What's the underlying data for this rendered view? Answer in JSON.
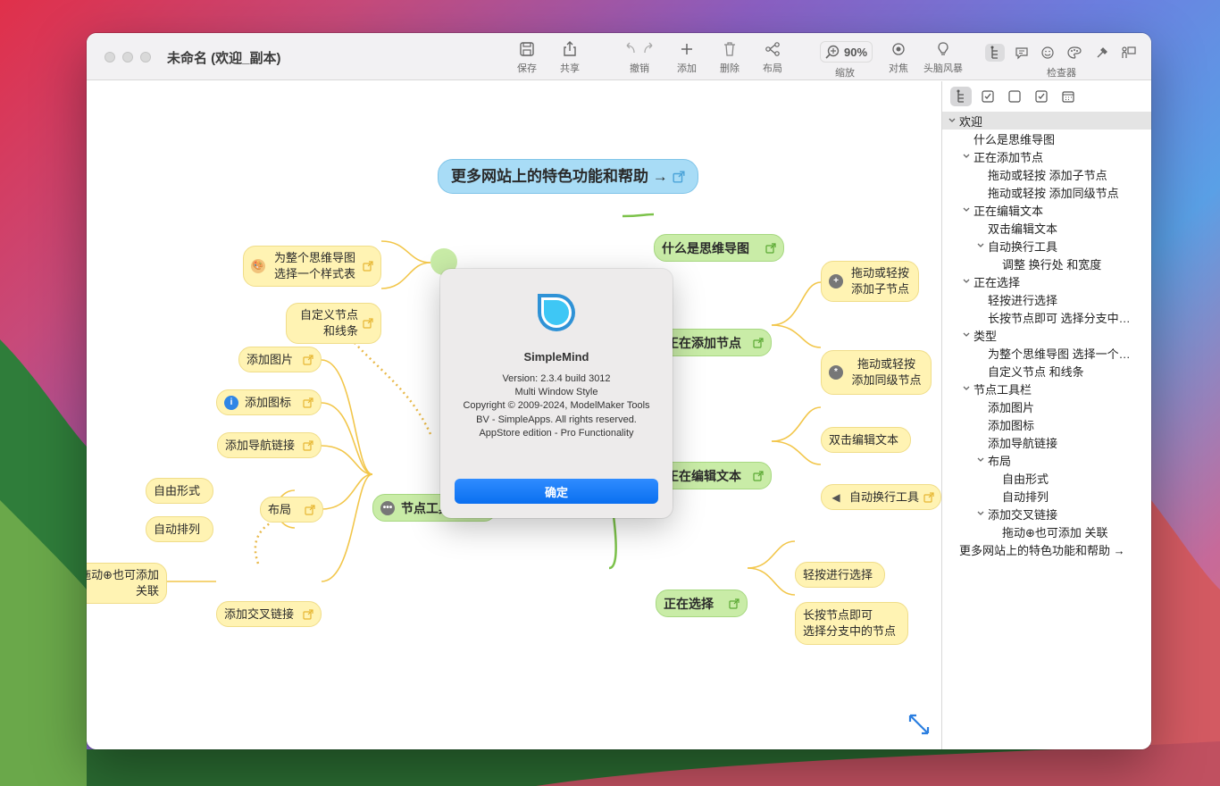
{
  "window": {
    "title": "未命名 (欢迎_副本)"
  },
  "toolbar": {
    "save": "保存",
    "share": "共享",
    "undo": "撤销",
    "add": "添加",
    "delete": "删除",
    "layout": "布局",
    "zoom": "缩放",
    "zoom_value": "90%",
    "focus": "对焦",
    "brainstorm": "头脑风暴",
    "inspector": "检查器"
  },
  "mindmap": {
    "top_link": "更多网站上的特色功能和帮助 →",
    "n_style": "为整个思维导图\n选择一个样式表",
    "n_custom": "自定义节点\n和线条",
    "n_addimg": "添加图片",
    "n_addicon": "添加图标",
    "n_addnav": "添加导航链接",
    "n_free": "自由形式",
    "n_auto": "自动排列",
    "n_layout": "布局",
    "n_cross_rel": "拖动⊕也可添加\n关联",
    "n_cross": "添加交叉链接",
    "n_toolbar": "节点工具栏",
    "n_what": "什么是思维导图",
    "n_adding": "正在添加节点",
    "n_drag_child": "拖动或轻按\n添加子节点",
    "n_drag_sib": "拖动或轻按\n添加同级节点",
    "n_editing": "正在编辑文本",
    "n_dbl": "双击编辑文本",
    "n_wrap": "自动换行工具",
    "n_selecting": "正在选择",
    "n_tap": "轻按进行选择",
    "n_long": "长按节点即可\n选择分支中的节点"
  },
  "about": {
    "app_name": "SimpleMind",
    "info": "Version: 2.3.4 build 3012\nMulti Window Style\nCopyright © 2009-2024, ModelMaker Tools BV - SimpleApps. All rights reserved.\nAppStore edition - Pro Functionality",
    "ok": "确定"
  },
  "outline": [
    "欢迎",
    "什么是思维导图",
    "正在添加节点",
    "拖动或轻按 添加子节点",
    "拖动或轻按 添加同级节点",
    "正在编辑文本",
    "双击编辑文本",
    "自动换行工具",
    "调整 换行处 和宽度",
    "正在选择",
    "轻按进行选择",
    "长按节点即可 选择分支中…",
    "类型",
    "为整个思维导图 选择一个…",
    "自定义节点 和线条",
    "节点工具栏",
    "添加图片",
    "添加图标",
    "添加导航链接",
    "布局",
    "自由形式",
    "自动排列",
    "添加交叉链接",
    "拖动⊕也可添加 关联",
    "更多网站上的特色功能和帮助 →"
  ],
  "colors": {
    "yellow_node": "#fff3b3",
    "green_node": "#c9eca7",
    "blue_node": "#a8dcf6",
    "accent": "#0a6ff0"
  }
}
